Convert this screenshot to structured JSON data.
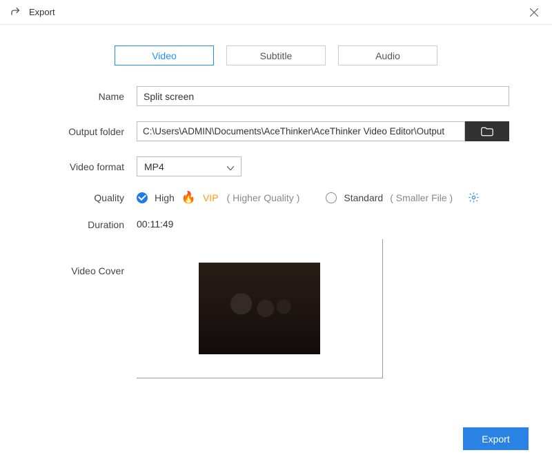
{
  "window": {
    "title": "Export"
  },
  "tabs": {
    "video": "Video",
    "subtitle": "Subtitle",
    "audio": "Audio"
  },
  "labels": {
    "name": "Name",
    "output_folder": "Output folder",
    "video_format": "Video format",
    "quality": "Quality",
    "duration": "Duration",
    "video_cover": "Video Cover"
  },
  "form": {
    "name": "Split screen",
    "output_folder": "C:\\Users\\ADMIN\\Documents\\AceThinker\\AceThinker Video Editor\\Output",
    "video_format": "MP4",
    "quality": {
      "high_label": "High",
      "vip_label": "VIP",
      "high_hint": "( Higher Quality )",
      "standard_label": "Standard",
      "standard_hint": "( Smaller File )"
    },
    "duration": "00:11:49"
  },
  "buttons": {
    "export": "Export"
  }
}
